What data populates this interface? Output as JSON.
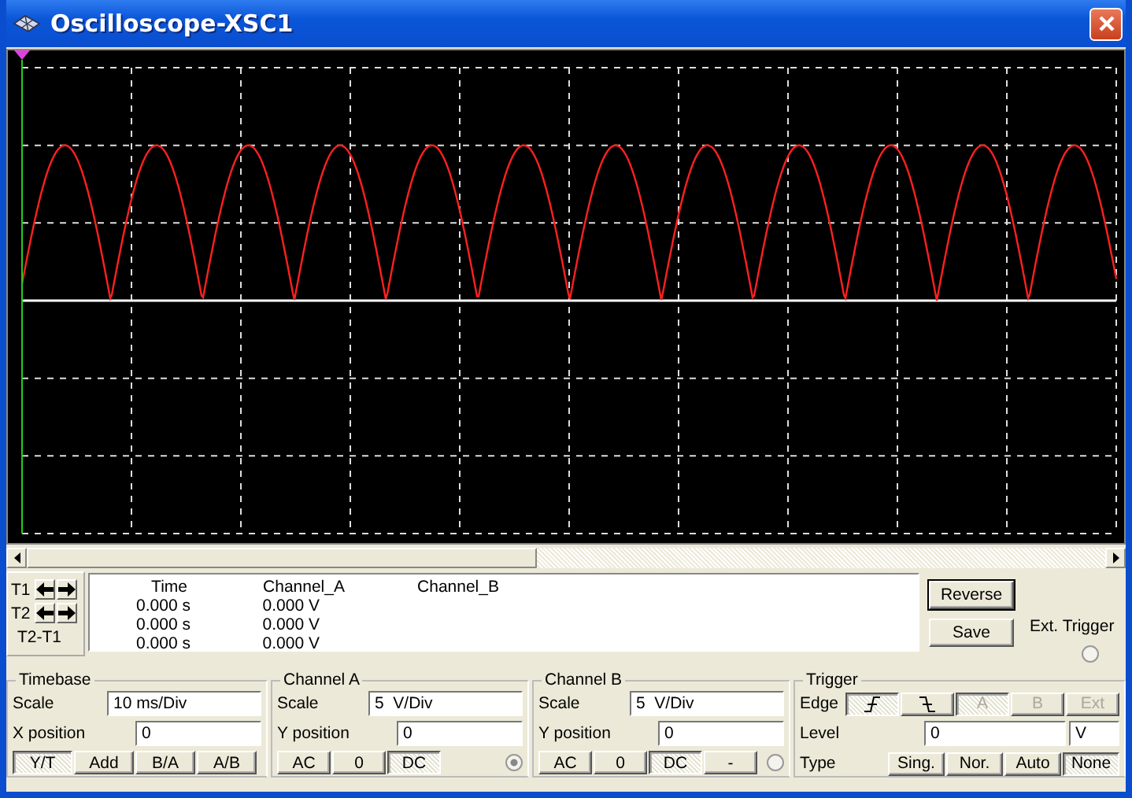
{
  "window": {
    "title": "Oscilloscope-XSC1"
  },
  "cursors": {
    "labels": [
      "T1",
      "T2"
    ],
    "difference_label": "T2-T1"
  },
  "readout": {
    "columns": [
      "Time",
      "Channel_A",
      "Channel_B"
    ],
    "rows": [
      [
        "0.000 s",
        "0.000 V"
      ],
      [
        "0.000 s",
        "0.000 V"
      ],
      [
        "0.000 s",
        "0.000 V"
      ]
    ]
  },
  "actions": [
    "Reverse",
    "Save"
  ],
  "ext_trigger": {
    "label": "Ext. Trigger"
  },
  "timebase": {
    "title": "Timebase",
    "scale_label": "Scale",
    "scale_value": "10 ms/Div",
    "position_label": "X position",
    "position_value": "0",
    "modes": [
      {
        "label": "Y/T",
        "selected": true
      },
      {
        "label": "Add",
        "selected": false
      },
      {
        "label": "B/A",
        "selected": false
      },
      {
        "label": "A/B",
        "selected": false
      }
    ]
  },
  "channels": [
    {
      "title": "Channel A",
      "scale_label": "Scale",
      "scale_value": "5  V/Div",
      "position_label": "Y position",
      "position_value": "0",
      "coupling": [
        {
          "label": "AC",
          "selected": false
        },
        {
          "label": "0",
          "selected": false
        },
        {
          "label": "DC",
          "selected": true
        }
      ]
    },
    {
      "title": "Channel B",
      "scale_label": "Scale",
      "scale_value": "5  V/Div",
      "position_label": "Y position",
      "position_value": "0",
      "coupling": [
        {
          "label": "AC",
          "selected": false
        },
        {
          "label": "0",
          "selected": false
        },
        {
          "label": "DC",
          "selected": true
        },
        {
          "label": "-",
          "selected": false
        }
      ]
    }
  ],
  "trigger": {
    "title": "Trigger",
    "edge_label": "Edge",
    "edges": [
      {
        "kind": "rising",
        "selected": true
      },
      {
        "kind": "falling",
        "selected": false
      }
    ],
    "sources": [
      {
        "label": "A",
        "selected": true,
        "disabled": true
      },
      {
        "label": "B",
        "selected": false,
        "disabled": true
      },
      {
        "label": "Ext",
        "selected": false,
        "disabled": true
      }
    ],
    "level_label": "Level",
    "level_value": "0",
    "level_unit": "V",
    "type_label": "Type",
    "types": [
      {
        "label": "Sing.",
        "selected": false
      },
      {
        "label": "Nor.",
        "selected": false
      },
      {
        "label": "Auto",
        "selected": false
      },
      {
        "label": "None",
        "selected": true
      }
    ]
  }
}
